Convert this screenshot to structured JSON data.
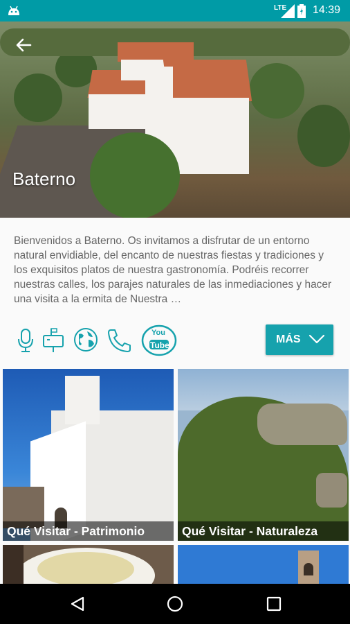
{
  "status": {
    "time": "14:39",
    "network": "LTE"
  },
  "header": {
    "title": "Baterno"
  },
  "description": "Bienvenidos a Baterno. Os invitamos a disfrutar de un entorno natural envidiable, del encanto de nuestras fiestas y tradiciones y los exquisitos platos de nuestra gastronomía. Podréis recorrer nuestras calles, los parajes naturales de las inmediaciones y hacer una visita a la ermita de Nuestra …",
  "actions": {
    "icons": [
      "microphone-icon",
      "mailbox-icon",
      "globe-icon",
      "phone-icon",
      "youtube-icon"
    ],
    "youtube_label_top": "You",
    "youtube_label_bottom": "Tube",
    "more_label": "MÁS"
  },
  "tiles": [
    {
      "label": "Qué Visitar - Patrimonio"
    },
    {
      "label": "Qué Visitar - Naturaleza"
    },
    {
      "label": ""
    },
    {
      "label": ""
    }
  ],
  "colors": {
    "accent": "#16a2ad",
    "statusbar": "#009ba6"
  }
}
